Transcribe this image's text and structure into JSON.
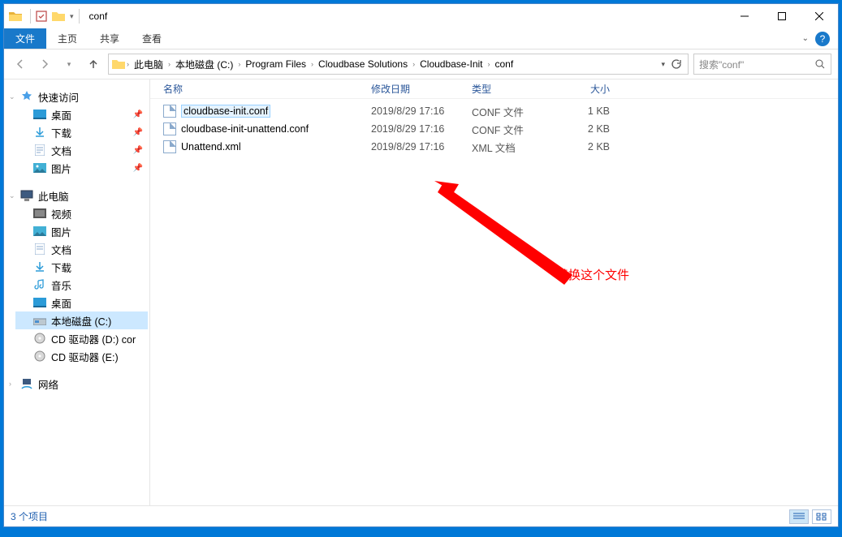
{
  "window": {
    "title": "conf"
  },
  "ribbon": {
    "file": "文件",
    "tabs": [
      "主页",
      "共享",
      "查看"
    ]
  },
  "breadcrumbs": [
    "此电脑",
    "本地磁盘 (C:)",
    "Program Files",
    "Cloudbase Solutions",
    "Cloudbase-Init",
    "conf"
  ],
  "search": {
    "placeholder": "搜索\"conf\""
  },
  "sidebar": {
    "quick": {
      "label": "快速访问",
      "items": [
        "桌面",
        "下载",
        "文档",
        "图片"
      ]
    },
    "pc": {
      "label": "此电脑",
      "items": [
        "视频",
        "图片",
        "文档",
        "下载",
        "音乐",
        "桌面",
        "本地磁盘 (C:)",
        "CD 驱动器 (D:) cor",
        "CD 驱动器 (E:)"
      ]
    },
    "network": {
      "label": "网络"
    }
  },
  "columns": {
    "name": "名称",
    "date": "修改日期",
    "type": "类型",
    "size": "大小"
  },
  "files": [
    {
      "name": "cloudbase-init.conf",
      "date": "2019/8/29 17:16",
      "type": "CONF 文件",
      "size": "1 KB",
      "selected": true
    },
    {
      "name": "cloudbase-init-unattend.conf",
      "date": "2019/8/29 17:16",
      "type": "CONF 文件",
      "size": "2 KB",
      "selected": false
    },
    {
      "name": "Unattend.xml",
      "date": "2019/8/29 17:16",
      "type": "XML 文档",
      "size": "2 KB",
      "selected": false
    }
  ],
  "annotation": "替换这个文件",
  "status": "3 个项目"
}
